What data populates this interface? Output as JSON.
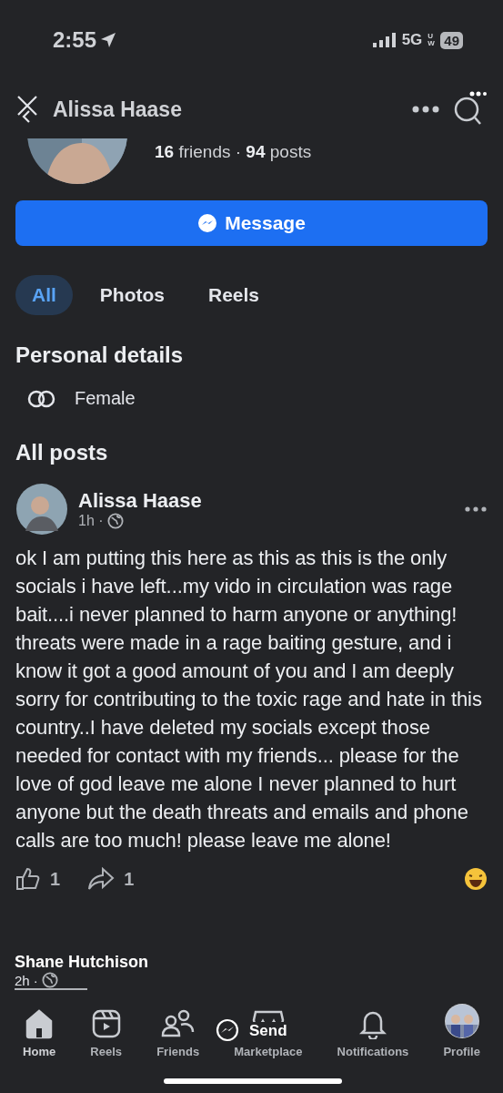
{
  "status_bar": {
    "time": "2:55",
    "network": "5G",
    "network_sub": "UW",
    "battery": "49"
  },
  "header": {
    "title": "Alissa Haase"
  },
  "profile": {
    "stats": "**16** friends · **94** posts"
  },
  "message_button": {
    "label": "Message"
  },
  "tabs": [
    {
      "label": "All",
      "selected": true
    },
    {
      "label": "Photos",
      "selected": false
    },
    {
      "label": "Reels",
      "selected": false
    }
  ],
  "personal_details": {
    "heading": "Personal details",
    "items": [
      {
        "label": "Female"
      }
    ]
  },
  "all_posts": {
    "heading": "All posts"
  },
  "post": {
    "author": "Alissa Haase",
    "time": "1h ·",
    "body": "ok I am putting this here as this as this is the only socials i have left...my vido in circulation was rage bait....i never planned to harm anyone or anything! threats were made in a rage baiting gesture, and i know it got a good amount of you and I am deeply sorry for contributing to the toxic rage and hate in this country..I have deleted my socials except those needed for contact with my friends... please for the love of god leave me alone I never planned to hurt anyone but the death threats and emails and phone calls are too much! please leave me alone!",
    "likes": "1",
    "shares": "1"
  },
  "overlay": {
    "name": "Shane Hutchison",
    "time": "2h ·",
    "send_label": "Send"
  },
  "nav": [
    {
      "kind": "home",
      "label": "Home",
      "selected": true
    },
    {
      "kind": "reels",
      "label": "Reels",
      "selected": false
    },
    {
      "kind": "friends",
      "label": "Friends",
      "selected": false
    },
    {
      "kind": "marketplace",
      "label": "Marketplace",
      "selected": false
    },
    {
      "kind": "notifications",
      "label": "Notifications",
      "selected": false
    },
    {
      "kind": "profile",
      "label": "Profile",
      "selected": false
    }
  ]
}
